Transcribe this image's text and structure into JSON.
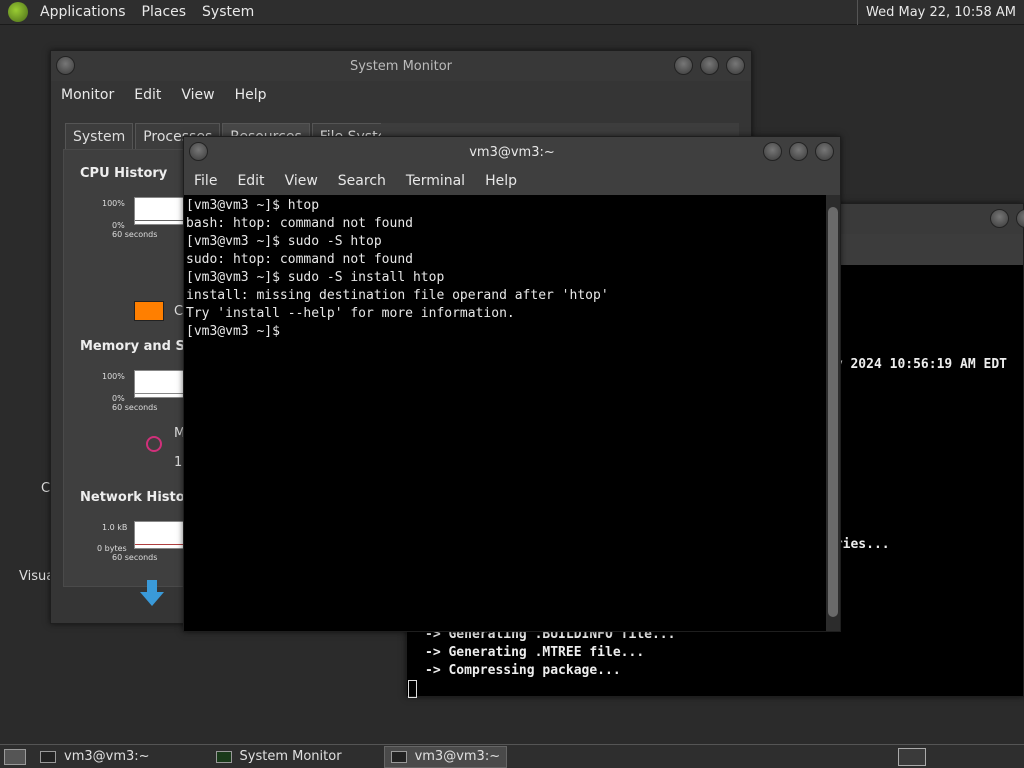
{
  "top_panel": {
    "menus": [
      "Applications",
      "Places",
      "System"
    ],
    "clock": "Wed May 22, 10:58 AM"
  },
  "desktop": {
    "icon_labels": [
      "C",
      "Visua"
    ]
  },
  "system_monitor": {
    "title": "System Monitor",
    "menus": [
      "Monitor",
      "Edit",
      "View",
      "Help"
    ],
    "tabs": [
      "System",
      "Processes",
      "Resources",
      "File Systems"
    ],
    "cpu": {
      "title": "CPU History",
      "y_top": "100%",
      "y_bottom": "0%",
      "x_label": "60 seconds",
      "legend_partial": "C"
    },
    "memory": {
      "title": "Memory and Swap",
      "y_top": "100%",
      "y_bottom": "0%",
      "x_label": "60 seconds",
      "legend_partial": "M",
      "value_partial": "1."
    },
    "network": {
      "title": "Network History",
      "y_top": "1.0 kB",
      "y_bottom": "0 bytes",
      "x_label": "60 seconds"
    }
  },
  "back_terminal": {
    "lines": [
      {
        "text": "ay 2024 10:56:19 AM EDT"
      },
      {
        "text": "aries..."
      },
      {
        "text": "-> Generating .BUILDINFO file..."
      },
      {
        "text": "-> Generating .MTREE file..."
      },
      {
        "text": "-> Compressing package..."
      }
    ]
  },
  "front_terminal": {
    "title": "vm3@vm3:~",
    "menus": [
      "File",
      "Edit",
      "View",
      "Search",
      "Terminal",
      "Help"
    ],
    "lines": [
      "[vm3@vm3 ~]$ htop",
      "bash: htop: command not found",
      "[vm3@vm3 ~]$ sudo -S htop",
      "sudo: htop: command not found",
      "[vm3@vm3 ~]$ sudo -S install htop",
      "install: missing destination file operand after 'htop'",
      "Try 'install --help' for more information.",
      "[vm3@vm3 ~]$ "
    ]
  },
  "taskbar": {
    "tasks": [
      {
        "label": "vm3@vm3:~",
        "icon": "terminal-icon",
        "active": false
      },
      {
        "label": "System Monitor",
        "icon": "system-monitor-icon",
        "active": false
      },
      {
        "label": "vm3@vm3:~",
        "icon": "terminal-icon",
        "active": true
      }
    ]
  }
}
